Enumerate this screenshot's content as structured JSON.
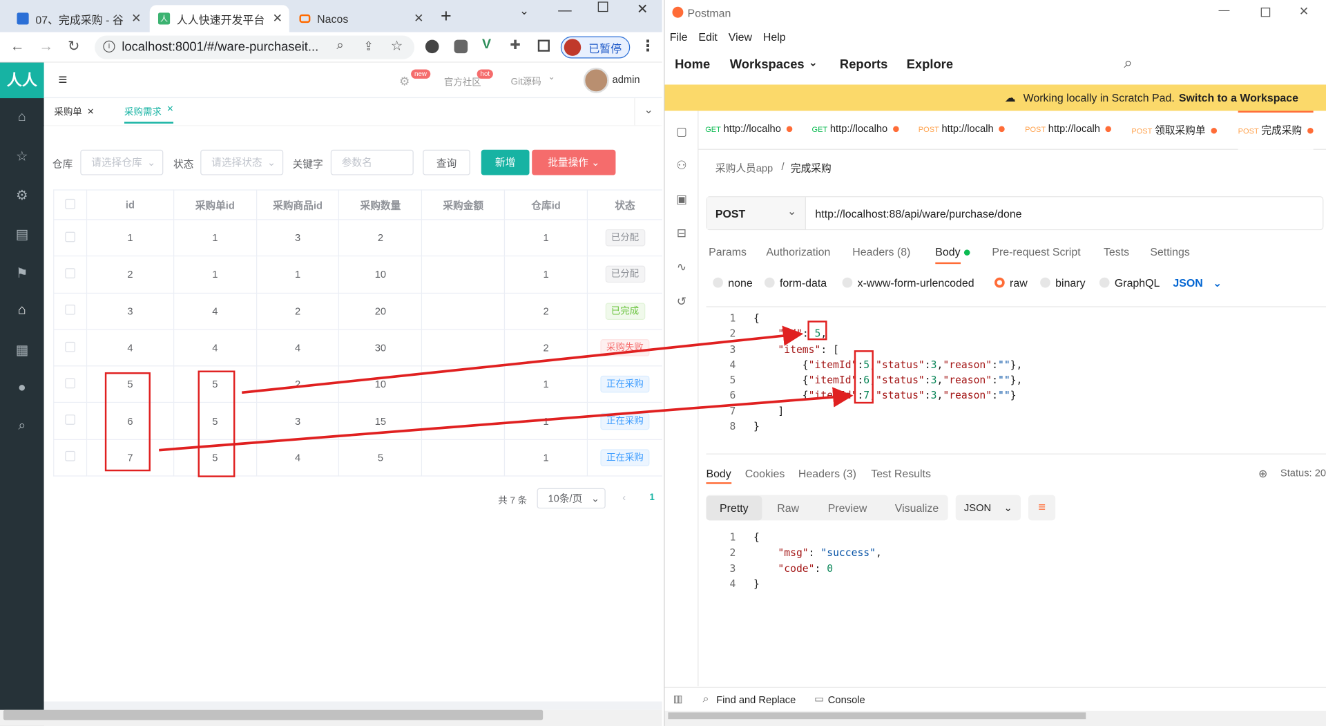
{
  "browser": {
    "tabs": [
      {
        "title": "07、完成采购 - 谷"
      },
      {
        "title": "人人快速开发平台"
      },
      {
        "title": "Nacos"
      }
    ],
    "url": "localhost:8001/#/ware-purchaseit...",
    "paused_label": "已暂停"
  },
  "app": {
    "logo": "人人",
    "header": {
      "badge_new": "new",
      "community": "官方社区",
      "badge_hot": "hot",
      "git": "Git源码",
      "user": "admin"
    },
    "tags": [
      "采购单",
      "采购需求"
    ],
    "filters": {
      "warehouse_label": "仓库",
      "warehouse_placeholder": "请选择仓库",
      "status_label": "状态",
      "status_placeholder": "请选择状态",
      "keyword_label": "关键字",
      "keyword_placeholder": "参数名",
      "query_button": "查询",
      "add_button": "新增",
      "batch_button": "批量操作"
    },
    "table": {
      "columns": [
        "id",
        "采购单id",
        "采购商品id",
        "采购数量",
        "采购金额",
        "仓库id",
        "状态"
      ],
      "rows": [
        [
          "1",
          "1",
          "3",
          "2",
          "",
          "1",
          "已分配"
        ],
        [
          "2",
          "1",
          "1",
          "10",
          "",
          "1",
          "已分配"
        ],
        [
          "3",
          "4",
          "2",
          "20",
          "",
          "2",
          "已完成"
        ],
        [
          "4",
          "4",
          "4",
          "30",
          "",
          "2",
          "采购失败"
        ],
        [
          "5",
          "5",
          "2",
          "10",
          "",
          "1",
          "正在采购"
        ],
        [
          "6",
          "5",
          "3",
          "15",
          "",
          "1",
          "正在采购"
        ],
        [
          "7",
          "5",
          "4",
          "5",
          "",
          "1",
          "正在采购"
        ]
      ]
    },
    "pagination": {
      "total": "共 7 条",
      "page_size": "10条/页",
      "current": "1"
    }
  },
  "postman": {
    "app_title": "Postman",
    "menu": [
      "File",
      "Edit",
      "View",
      "Help"
    ],
    "nav": [
      "Home",
      "Workspaces",
      "Reports",
      "Explore"
    ],
    "banner": {
      "text": "Working locally in Scratch Pad.",
      "link": "Switch to a Workspace"
    },
    "request_tabs": [
      {
        "method": "GET",
        "name": "http://localho"
      },
      {
        "method": "GET",
        "name": "http://localho"
      },
      {
        "method": "POST",
        "name": "http://localh"
      },
      {
        "method": "POST",
        "name": "http://localh"
      },
      {
        "method": "POST",
        "name": "领取采购单"
      },
      {
        "method": "POST",
        "name": "完成采购"
      }
    ],
    "breadcrumb": {
      "collection": "采购人员app",
      "request": "完成采购"
    },
    "method": "POST",
    "url": "http://localhost:88/api/ware/purchase/done",
    "request_subtabs": [
      "Params",
      "Authorization",
      "Headers (8)",
      "Body",
      "Pre-request Script",
      "Tests",
      "Settings"
    ],
    "body_types": [
      "none",
      "form-data",
      "x-www-form-urlencoded",
      "raw",
      "binary",
      "GraphQL"
    ],
    "body_format": "JSON",
    "request_body": {
      "id": "5",
      "items": [
        {
          "itemId": "5",
          "status": "3",
          "reason": ""
        },
        {
          "itemId": "6",
          "status": "3",
          "reason": ""
        },
        {
          "itemId": "7",
          "status": "3",
          "reason": ""
        }
      ]
    },
    "response_tabs": [
      "Body",
      "Cookies",
      "Headers (3)",
      "Test Results"
    ],
    "status_label": "Status: 20",
    "view_modes": [
      "Pretty",
      "Raw",
      "Preview",
      "Visualize"
    ],
    "response_format": "JSON",
    "response_body": {
      "msg": "success",
      "code": "0"
    },
    "footer": {
      "find": "Find and Replace",
      "console": "Console"
    }
  },
  "colors": {
    "accent": "#17b3a3",
    "danger": "#f56c6c",
    "annotation": "#e02020",
    "postman_orange": "#ff6c37",
    "banner": "#fbd96a"
  }
}
